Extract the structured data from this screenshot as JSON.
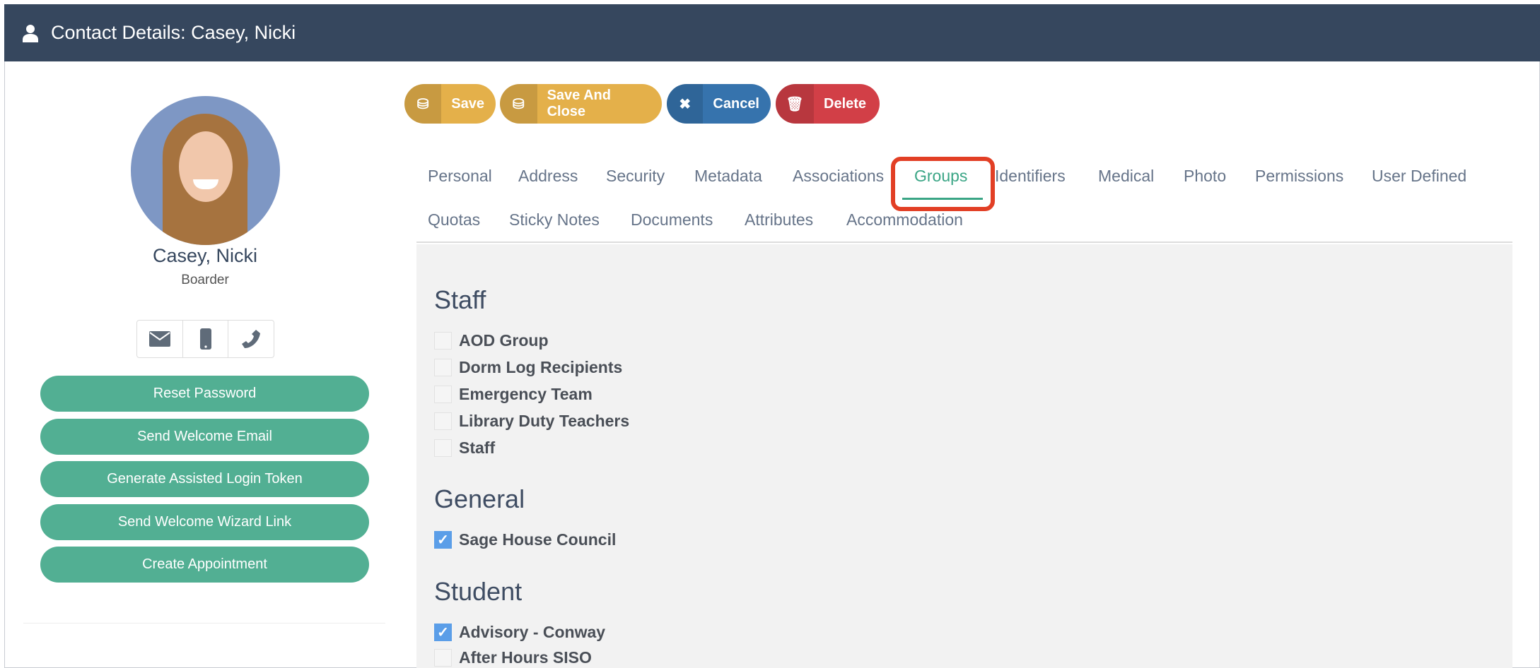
{
  "header": {
    "title": "Contact Details: Casey, Nicki",
    "icon": "user-icon"
  },
  "profile": {
    "name": "Casey, Nicki",
    "role": "Boarder"
  },
  "contact_icons": [
    "envelope-icon",
    "mobile-icon",
    "phone-icon"
  ],
  "side_buttons": [
    "Reset Password",
    "Send Welcome Email",
    "Generate Assisted Login Token",
    "Send Welcome Wizard Link",
    "Create Appointment"
  ],
  "actions": {
    "save": "Save",
    "save_close": "Save And Close",
    "cancel": "Cancel",
    "delete": "Delete"
  },
  "tabs": [
    "Personal",
    "Address",
    "Security",
    "Metadata",
    "Associations",
    "Groups",
    "Identifiers",
    "Medical",
    "Photo",
    "Permissions",
    "User Defined",
    "Quotas",
    "Sticky Notes",
    "Documents",
    "Attributes",
    "Accommodation"
  ],
  "active_tab": "Groups",
  "groups": {
    "staff": {
      "title": "Staff",
      "items": [
        {
          "label": "AOD Group",
          "checked": false
        },
        {
          "label": "Dorm Log Recipients",
          "checked": false
        },
        {
          "label": "Emergency Team",
          "checked": false
        },
        {
          "label": "Library Duty Teachers",
          "checked": false
        },
        {
          "label": "Staff",
          "checked": false
        }
      ]
    },
    "general": {
      "title": "General",
      "items": [
        {
          "label": "Sage House Council",
          "checked": true
        }
      ]
    },
    "student": {
      "title": "Student",
      "items": [
        {
          "label": "Advisory - Conway",
          "checked": true
        },
        {
          "label": "After Hours SISO",
          "checked": false
        }
      ]
    }
  },
  "colors": {
    "header": "#36475e",
    "green": "#52af93",
    "save": "#e4b04a",
    "cancel": "#3673ad",
    "delete": "#d23f47",
    "highlight": "#e23f25"
  }
}
